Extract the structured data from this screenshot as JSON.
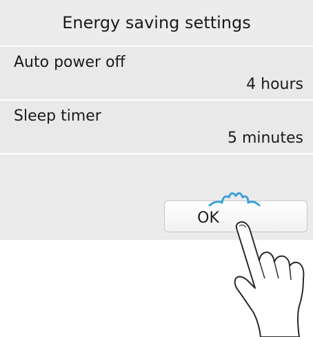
{
  "header": {
    "title": "Energy saving settings"
  },
  "settings": [
    {
      "label": "Auto power off",
      "value": "4 hours"
    },
    {
      "label": "Sleep timer",
      "value": "5 minutes"
    }
  ],
  "ok_button": {
    "label": "OK"
  },
  "colors": {
    "screen_background": "#ebebeb",
    "accent_tap_mark": "#3aa0d8",
    "button_border": "#c8c8c8"
  },
  "icons": {
    "tap_indicator": "tap-sparkle-icon",
    "hand": "pointing-hand-icon"
  }
}
